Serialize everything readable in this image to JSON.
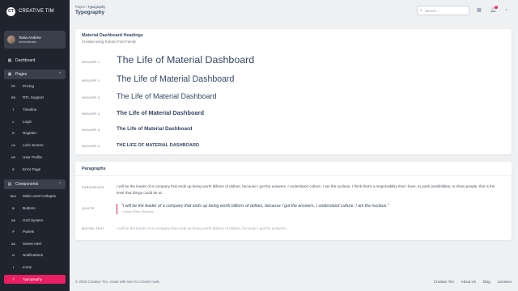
{
  "brand": {
    "logo": "CT",
    "name": "CREATIVE TIM"
  },
  "user": {
    "name": "Tania Andrew",
    "role": "Administrator"
  },
  "nav": {
    "dashboard": {
      "label": "Dashboard",
      "icon": "dashboard-icon"
    },
    "pages": {
      "label": "Pages",
      "icon": "image-icon"
    },
    "pages_items": [
      {
        "abbr": "PP",
        "label": "Pricing"
      },
      {
        "abbr": "RS",
        "label": "RTL Support"
      },
      {
        "abbr": "T",
        "label": "Timeline"
      },
      {
        "abbr": "L",
        "label": "Login"
      },
      {
        "abbr": "R",
        "label": "Register"
      },
      {
        "abbr": "LS",
        "label": "Lock Screen"
      },
      {
        "abbr": "UP",
        "label": "User Profile"
      },
      {
        "abbr": "E",
        "label": "Error Page"
      }
    ],
    "components": {
      "label": "Components",
      "icon": "apps-icon"
    },
    "components_items": [
      {
        "abbr": "MLC",
        "label": "Multi Level Collapse"
      },
      {
        "abbr": "B",
        "label": "Buttons"
      },
      {
        "abbr": "GS",
        "label": "Grid System"
      },
      {
        "abbr": "P",
        "label": "Panels"
      },
      {
        "abbr": "SA",
        "label": "Sweet Alert"
      },
      {
        "abbr": "N",
        "label": "Notifications"
      },
      {
        "abbr": "I",
        "label": "Icons"
      },
      {
        "abbr": "T",
        "label": "Typography"
      }
    ]
  },
  "header": {
    "breadcrumb_root": "Pages",
    "breadcrumb_sep": "/",
    "breadcrumb_current": "Typography",
    "title": "Typography",
    "search_placeholder": "Search...",
    "notification_count": "5"
  },
  "headings_card": {
    "title": "Material Dashboard Headings",
    "subtitle": "Created using Roboto Font Family",
    "rows": [
      {
        "label": "HEADER 1",
        "text": "The Life of Material Dashboard"
      },
      {
        "label": "HEADER 2",
        "text": "The Life of Material Dashboard"
      },
      {
        "label": "HEADER 3",
        "text": "The Life of Material Dashboard"
      },
      {
        "label": "HEADER 4",
        "text": "The Life of Material Dashboard"
      },
      {
        "label": "HEADER 5",
        "text": "The Life of Material Dashboard"
      },
      {
        "label": "HEADER 6",
        "text": "THE LIFE OF MATERIAL DASHBOARD"
      }
    ]
  },
  "paragraphs_card": {
    "title": "Paragraphs",
    "paragraph_label": "PARAGRAPH",
    "paragraph_text": "I will be the leader of a company that ends up being worth billions of dollars, because I got the answers. I understand culture. I am the nucleus. I think that's a responsibility that I have, to push possibilities, to show people, this is the level that things could be at.",
    "quote_label": "QUOTE",
    "quote_text": "\"I will be the leader of a company that ends up being worth billions of dollars, because I got the answers. I understand culture. I am the nucleus.\"",
    "quote_author": "- Kanye West, Musician",
    "muted_label": "MUTED TEXT",
    "muted_text": "I will be the leader of a company that ends up being worth billions of dollars, because I got the answers..."
  },
  "footer": {
    "copyright": "© 2026 Creative Tim, made with love for a better web.",
    "links": [
      "Creative Tim",
      "About Us",
      "Blog",
      "Licenses"
    ]
  },
  "colors": {
    "accent": "#e91e63",
    "sidebar": "#20242f",
    "background": "#eef0f2"
  }
}
